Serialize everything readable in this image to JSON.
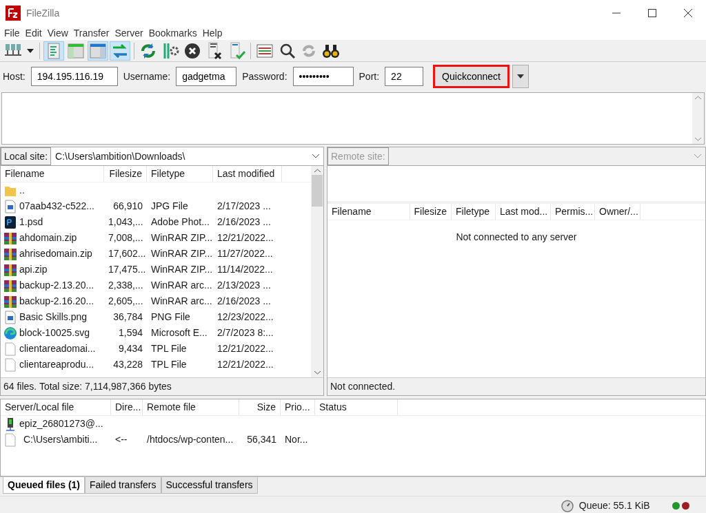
{
  "window": {
    "title": "FileZilla"
  },
  "menu": [
    "File",
    "Edit",
    "View",
    "Transfer",
    "Server",
    "Bookmarks",
    "Help"
  ],
  "toolbar": [
    {
      "kind": "sites"
    },
    {
      "kind": "dropdown"
    },
    {
      "kind": "sep"
    },
    {
      "kind": "log",
      "on": true
    },
    {
      "kind": "localtree",
      "on": false
    },
    {
      "kind": "remotetree",
      "on": true
    },
    {
      "kind": "queue",
      "on": true
    },
    {
      "kind": "sep"
    },
    {
      "kind": "refresh"
    },
    {
      "kind": "filter"
    },
    {
      "kind": "cancel"
    },
    {
      "kind": "disconnect"
    },
    {
      "kind": "reconnect"
    },
    {
      "kind": "sep"
    },
    {
      "kind": "compare"
    },
    {
      "kind": "search"
    },
    {
      "kind": "sync"
    },
    {
      "kind": "binoculars"
    }
  ],
  "quickconnect": {
    "host_label": "Host:",
    "host": "194.195.116.19",
    "username_label": "Username:",
    "username": "gadgetma",
    "password_label": "Password:",
    "password": "•••••••••",
    "port_label": "Port:",
    "port": "22",
    "button": "Quickconnect",
    "highlighted": true
  },
  "local": {
    "site_label": "Local site:",
    "path": "C:\\Users\\ambition\\Downloads\\",
    "columns": [
      "Filename",
      "Filesize",
      "Filetype",
      "Last modified"
    ],
    "rows": [
      {
        "kind": "folder",
        "name": "..",
        "size": "",
        "type": "",
        "modified": ""
      },
      {
        "kind": "image",
        "name": "07aab432-c522...",
        "size": "66,910",
        "type": "JPG File",
        "modified": "2/17/2023 ..."
      },
      {
        "kind": "psd",
        "name": "1.psd",
        "size": "1,043,...",
        "type": "Adobe Phot...",
        "modified": "2/16/2023 ..."
      },
      {
        "kind": "archive",
        "name": "ahdomain.zip",
        "size": "7,008,...",
        "type": "WinRAR ZIP...",
        "modified": "12/21/2022..."
      },
      {
        "kind": "archive",
        "name": "ahrisedomain.zip",
        "size": "17,602...",
        "type": "WinRAR ZIP...",
        "modified": "11/27/2022..."
      },
      {
        "kind": "archive",
        "name": "api.zip",
        "size": "17,475...",
        "type": "WinRAR ZIP...",
        "modified": "11/14/2022..."
      },
      {
        "kind": "archive",
        "name": "backup-2.13.20...",
        "size": "2,338,...",
        "type": "WinRAR arc...",
        "modified": "2/13/2023 ..."
      },
      {
        "kind": "archive",
        "name": "backup-2.16.20...",
        "size": "2,605,...",
        "type": "WinRAR arc...",
        "modified": "2/16/2023 ..."
      },
      {
        "kind": "image",
        "name": "Basic Skills.png",
        "size": "36,784",
        "type": "PNG File",
        "modified": "12/23/2022..."
      },
      {
        "kind": "browser",
        "name": "block-10025.svg",
        "size": "1,594",
        "type": "Microsoft E...",
        "modified": "2/7/2023 8:..."
      },
      {
        "kind": "file",
        "name": "clientareadomai...",
        "size": "9,434",
        "type": "TPL File",
        "modified": "12/21/2022..."
      },
      {
        "kind": "file",
        "name": "clientareaprodu...",
        "size": "43,228",
        "type": "TPL File",
        "modified": "12/21/2022..."
      }
    ],
    "status": "64 files. Total size: 7,114,987,366 bytes"
  },
  "remote": {
    "site_label": "Remote site:",
    "columns": [
      "Filename",
      "Filesize",
      "Filetype",
      "Last mod...",
      "Permis...",
      "Owner/..."
    ],
    "message": "Not connected to any server",
    "status": "Not connected."
  },
  "queue": {
    "columns": [
      "Server/Local file",
      "Dire...",
      "Remote file",
      "Size",
      "Prio...",
      "Status"
    ],
    "rows": [
      {
        "kind": "server",
        "local": "epiz_26801273@...",
        "direction": "",
        "remote": "",
        "size": "",
        "priority": "",
        "status": ""
      },
      {
        "kind": "file",
        "local": "C:\\Users\\ambiti...",
        "direction": "<--",
        "remote": "/htdocs/wp-conten...",
        "size": "56,341",
        "priority": "Nor...",
        "status": ""
      }
    ]
  },
  "tabs": [
    {
      "label": "Queued files (1)",
      "selected": true
    },
    {
      "label": "Failed transfers",
      "selected": false
    },
    {
      "label": "Successful transfers",
      "selected": false
    }
  ],
  "status_bar": {
    "queue": "Queue: 55.1 KiB",
    "lights": [
      {
        "color": "#1f9a2a"
      },
      {
        "color": "#a01c22"
      }
    ]
  }
}
